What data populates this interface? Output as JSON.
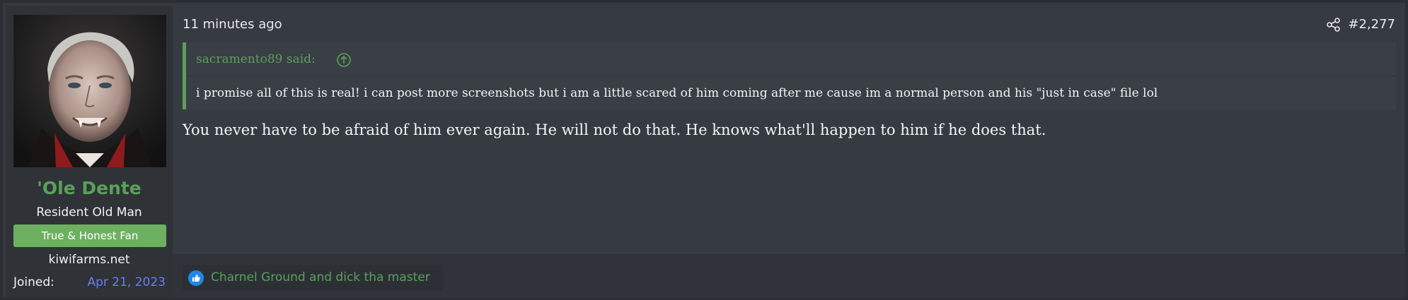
{
  "user": {
    "avatar_icon": "avatar-portrait",
    "name": "'Ole Dente",
    "title": "Resident Old Man",
    "banner": "True & Honest Fan",
    "site": "kiwifarms.net",
    "joined_label": "Joined:",
    "joined_date": "Apr 21, 2023"
  },
  "post": {
    "timestamp": "11 minutes ago",
    "share_icon": "share-icon",
    "number": "#2,277",
    "quote": {
      "author": "sacramento89 said:",
      "arrow_icon": "arrow-up-circle-icon",
      "text": "i promise all of this is real! i can post more screenshots but i am a little scared of him coming after me cause im a normal person and his \"just in case\" file lol"
    },
    "body": "You never have to be afraid of him ever again. He will not do that. He knows what'll happen to him if he does that.",
    "reactions": {
      "icon": "like-icon",
      "users": "Charnel Ground and dick tha master"
    }
  },
  "colors": {
    "accent_green": "#5aa05a",
    "banner_green": "#6cb060",
    "link_blue": "#6a7cf0",
    "like_blue": "#1f87e8"
  }
}
